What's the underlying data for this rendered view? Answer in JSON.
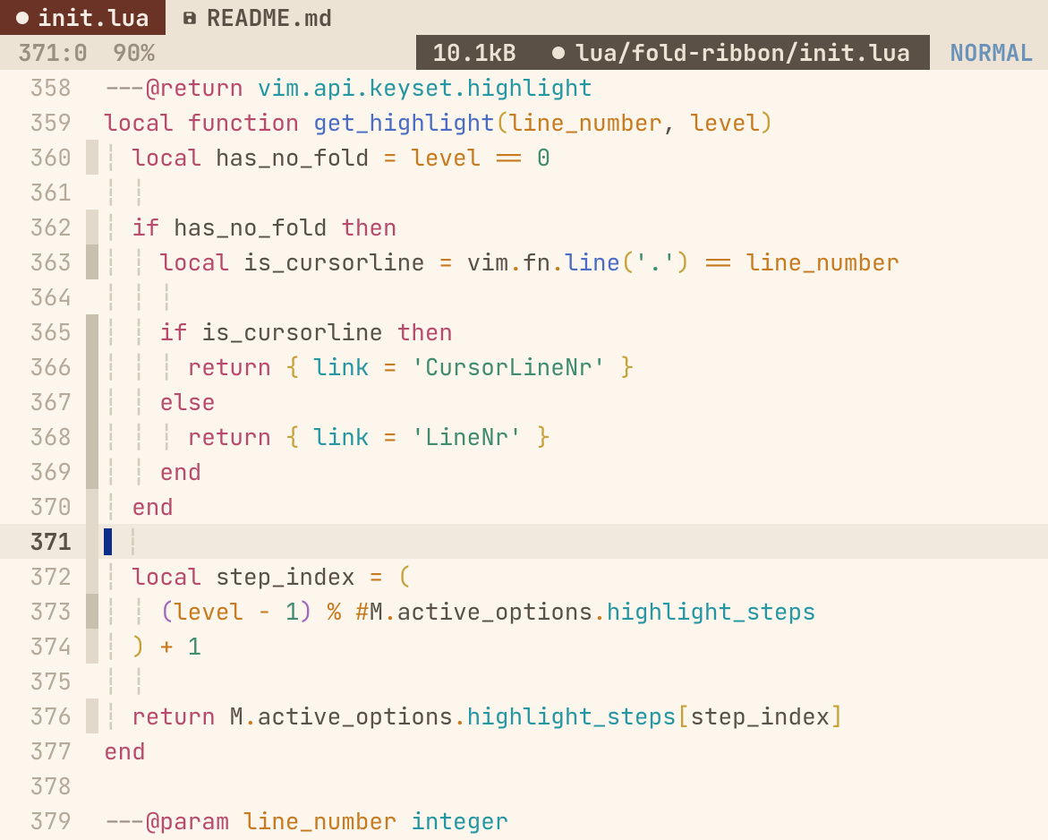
{
  "tabs": [
    {
      "label": "init.lua",
      "active": true,
      "icon": "dot"
    },
    {
      "label": "README.md",
      "active": false,
      "icon": "save"
    }
  ],
  "status": {
    "ruler": "371:0",
    "percent": "90%",
    "filesize": "10.1kB",
    "filepath": "lua/fold-ribbon/init.lua",
    "mode": "NORMAL"
  },
  "editor": {
    "lines": [
      {
        "n": "358",
        "fold": "",
        "tokens": [
          [
            "t-comment",
            "---"
          ],
          [
            "t-anno",
            "@return"
          ],
          [
            "t-comment",
            " "
          ],
          [
            "t-type",
            "vim.api.keyset.highlight"
          ]
        ]
      },
      {
        "n": "359",
        "fold": "",
        "tokens": [
          [
            "t-kw",
            "local "
          ],
          [
            "t-kw",
            "function "
          ],
          [
            "t-fn",
            "get_highlight"
          ],
          [
            "t-punc1",
            "("
          ],
          [
            "t-param",
            "line_number"
          ],
          [
            "t-ident",
            ", "
          ],
          [
            "t-param",
            "level"
          ],
          [
            "t-punc1",
            ")"
          ]
        ]
      },
      {
        "n": "360",
        "fold": "shade",
        "tokens": [
          [
            "indent-guide",
            "┆ "
          ],
          [
            "t-kw",
            "local "
          ],
          [
            "t-ident",
            "has_no_fold "
          ],
          [
            "t-op",
            "= "
          ],
          [
            "t-var",
            "level "
          ],
          [
            "t-op",
            "== "
          ],
          [
            "t-num",
            "0"
          ]
        ]
      },
      {
        "n": "361",
        "fold": "",
        "tokens": [
          [
            "indent-guide",
            "┆ ┆"
          ]
        ]
      },
      {
        "n": "362",
        "fold": "shade",
        "tokens": [
          [
            "indent-guide",
            "┆ "
          ],
          [
            "t-kw",
            "if "
          ],
          [
            "t-ident",
            "has_no_fold "
          ],
          [
            "t-kw",
            "then"
          ]
        ]
      },
      {
        "n": "363",
        "fold": "dark",
        "tokens": [
          [
            "indent-guide",
            "┆ ┆ "
          ],
          [
            "t-kw",
            "local "
          ],
          [
            "t-ident",
            "is_cursorline "
          ],
          [
            "t-op",
            "= "
          ],
          [
            "t-ident",
            "vim"
          ],
          [
            "t-op",
            "."
          ],
          [
            "t-ident",
            "fn"
          ],
          [
            "t-op",
            "."
          ],
          [
            "t-fn",
            "line"
          ],
          [
            "t-punc1",
            "("
          ],
          [
            "t-str",
            "'.'"
          ],
          [
            "t-punc1",
            ") "
          ],
          [
            "t-op",
            "== "
          ],
          [
            "t-var",
            "line_number"
          ]
        ]
      },
      {
        "n": "364",
        "fold": "",
        "tokens": [
          [
            "indent-guide",
            "┆ ┆ ┆"
          ]
        ]
      },
      {
        "n": "365",
        "fold": "dark",
        "tokens": [
          [
            "indent-guide",
            "┆ ┆ "
          ],
          [
            "t-kw",
            "if "
          ],
          [
            "t-ident",
            "is_cursorline "
          ],
          [
            "t-kw",
            "then"
          ]
        ]
      },
      {
        "n": "366",
        "fold": "dark",
        "tokens": [
          [
            "indent-guide",
            "┆ ┆ ┆ "
          ],
          [
            "t-kw",
            "return "
          ],
          [
            "t-punc1",
            "{ "
          ],
          [
            "t-field",
            "link "
          ],
          [
            "t-op",
            "= "
          ],
          [
            "t-str",
            "'CursorLineNr'"
          ],
          [
            "t-punc1",
            " }"
          ]
        ]
      },
      {
        "n": "367",
        "fold": "dark",
        "tokens": [
          [
            "indent-guide",
            "┆ ┆ "
          ],
          [
            "t-kw",
            "else"
          ]
        ]
      },
      {
        "n": "368",
        "fold": "dark",
        "tokens": [
          [
            "indent-guide",
            "┆ ┆ ┆ "
          ],
          [
            "t-kw",
            "return "
          ],
          [
            "t-punc1",
            "{ "
          ],
          [
            "t-field",
            "link "
          ],
          [
            "t-op",
            "= "
          ],
          [
            "t-str",
            "'LineNr'"
          ],
          [
            "t-punc1",
            " }"
          ]
        ]
      },
      {
        "n": "369",
        "fold": "dark",
        "tokens": [
          [
            "indent-guide",
            "┆ ┆ "
          ],
          [
            "t-kw",
            "end"
          ]
        ]
      },
      {
        "n": "370",
        "fold": "shade",
        "tokens": [
          [
            "indent-guide",
            "┆ "
          ],
          [
            "t-kw",
            "end"
          ]
        ]
      },
      {
        "n": "371",
        "fold": "shade",
        "tokens": [],
        "current": true,
        "cursor": true
      },
      {
        "n": "372",
        "fold": "shade",
        "tokens": [
          [
            "indent-guide",
            "┆ "
          ],
          [
            "t-kw",
            "local "
          ],
          [
            "t-ident",
            "step_index "
          ],
          [
            "t-op",
            "= "
          ],
          [
            "t-punc1",
            "("
          ]
        ]
      },
      {
        "n": "373",
        "fold": "dark",
        "tokens": [
          [
            "indent-guide",
            "┆ ┆ "
          ],
          [
            "t-punc2",
            "("
          ],
          [
            "t-var",
            "level "
          ],
          [
            "t-op",
            "- "
          ],
          [
            "t-num",
            "1"
          ],
          [
            "t-punc2",
            ") "
          ],
          [
            "t-op",
            "% #"
          ],
          [
            "t-ident",
            "M"
          ],
          [
            "t-op",
            "."
          ],
          [
            "t-ident",
            "active_options"
          ],
          [
            "t-op",
            "."
          ],
          [
            "t-field",
            "highlight_steps"
          ]
        ]
      },
      {
        "n": "374",
        "fold": "shade",
        "tokens": [
          [
            "indent-guide",
            "┆ "
          ],
          [
            "t-punc1",
            ") "
          ],
          [
            "t-op",
            "+ "
          ],
          [
            "t-num",
            "1"
          ]
        ]
      },
      {
        "n": "375",
        "fold": "",
        "tokens": [
          [
            "indent-guide",
            "┆ ┆"
          ]
        ]
      },
      {
        "n": "376",
        "fold": "shade",
        "tokens": [
          [
            "indent-guide",
            "┆ "
          ],
          [
            "t-kw",
            "return "
          ],
          [
            "t-ident",
            "M"
          ],
          [
            "t-op",
            "."
          ],
          [
            "t-ident",
            "active_options"
          ],
          [
            "t-op",
            "."
          ],
          [
            "t-field",
            "highlight_steps"
          ],
          [
            "t-punc1",
            "["
          ],
          [
            "t-ident",
            "step_index"
          ],
          [
            "t-punc1",
            "]"
          ]
        ]
      },
      {
        "n": "377",
        "fold": "",
        "tokens": [
          [
            "t-kw",
            "end"
          ]
        ]
      },
      {
        "n": "378",
        "fold": "",
        "tokens": []
      },
      {
        "n": "379",
        "fold": "",
        "tokens": [
          [
            "t-comment",
            "---"
          ],
          [
            "t-anno",
            "@param"
          ],
          [
            "t-comment",
            " "
          ],
          [
            "t-var",
            "line_number"
          ],
          [
            "t-comment",
            " "
          ],
          [
            "t-type",
            "integer"
          ]
        ]
      }
    ]
  }
}
